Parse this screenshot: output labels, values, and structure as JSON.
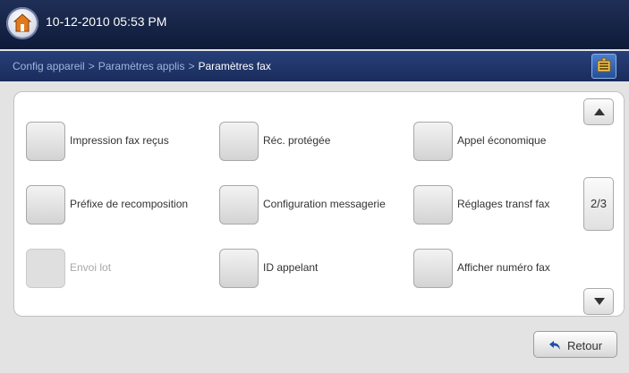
{
  "header": {
    "datetime": "10-12-2010 05:53 PM"
  },
  "breadcrumb": {
    "items": [
      "Config appareil",
      "Paramètres applis",
      "Paramètres fax"
    ],
    "separator": ">"
  },
  "options": [
    {
      "label": "Impression fax reçus",
      "enabled": true
    },
    {
      "label": "Réc. protégée",
      "enabled": true
    },
    {
      "label": "Appel économique",
      "enabled": true
    },
    {
      "label": "Préfixe de recomposition",
      "enabled": true
    },
    {
      "label": "Configuration messagerie",
      "enabled": true
    },
    {
      "label": "Réglages transf fax",
      "enabled": true
    },
    {
      "label": "Envoi lot",
      "enabled": false
    },
    {
      "label": "ID appelant",
      "enabled": true
    },
    {
      "label": "Afficher numéro fax",
      "enabled": true
    }
  ],
  "pagination": {
    "indicator": "2/3"
  },
  "footer": {
    "back_label": "Retour"
  },
  "colors": {
    "topbar": "#0f1a38",
    "breadcrumb_bar": "#1a2c5c",
    "background": "#e3e3e3"
  }
}
